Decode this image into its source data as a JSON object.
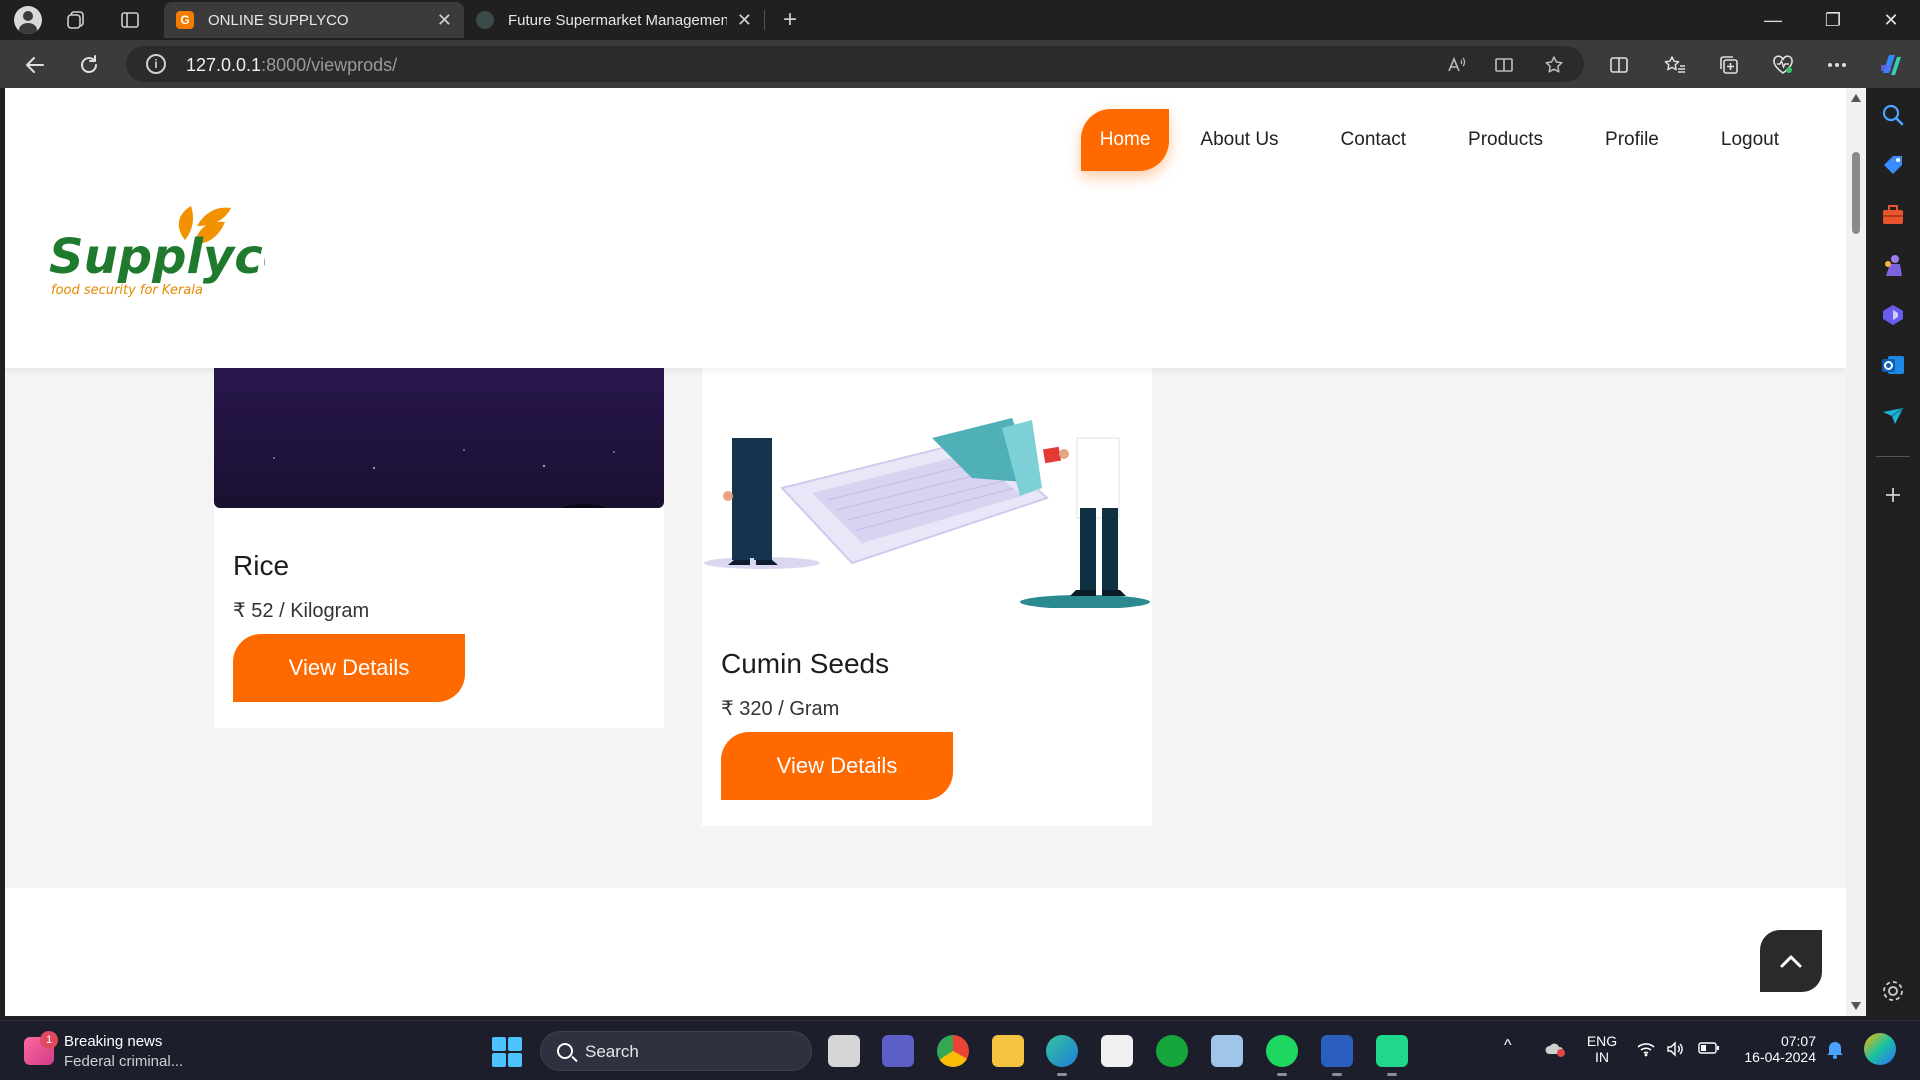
{
  "browser": {
    "tabs": [
      {
        "title": "ONLINE SUPPLYCO",
        "active": true
      },
      {
        "title": "Future Supermarket Managemen",
        "active": false
      }
    ],
    "new_tab_symbol": "+",
    "close_symbol": "✕",
    "url_host": "127.0.0.1",
    "url_path": ":8000/viewprods/",
    "info_symbol": "i",
    "window_controls": {
      "minimize": "—",
      "restore": "❐",
      "close": "✕"
    },
    "toolbar_icons": [
      "read-aloud-icon",
      "immersive-reader-icon",
      "favorite-star-icon",
      "split-screen-icon",
      "favorites-icon",
      "collections-icon",
      "browser-essentials-icon",
      "more-icon",
      "copilot-icon"
    ]
  },
  "site": {
    "logo": {
      "brand": "Supplyco",
      "tagline": "food security for Kerala"
    },
    "nav": [
      "Home",
      "About Us",
      "Contact",
      "Products",
      "Profile",
      "Logout"
    ],
    "active_nav": "Home"
  },
  "products": [
    {
      "name": "Rice",
      "price": "₹ 52 / Kilogram",
      "button": "View Details"
    },
    {
      "name": "Cumin Seeds",
      "price": "₹ 320 / Gram",
      "button": "View Details"
    }
  ],
  "colors": {
    "accent": "#ff6a00",
    "page_bg": "#f4f4f6",
    "brand_green": "#1f7a2e",
    "brand_orange": "#f39200"
  },
  "taskbar": {
    "news_badge": "1",
    "news_title": "Breaking news",
    "news_sub": "Federal criminal...",
    "search_placeholder": "Search",
    "lang_top": "ENG",
    "lang_bottom": "IN",
    "time": "07:07",
    "date": "16-04-2024",
    "tray_overflow_symbol": "^"
  }
}
